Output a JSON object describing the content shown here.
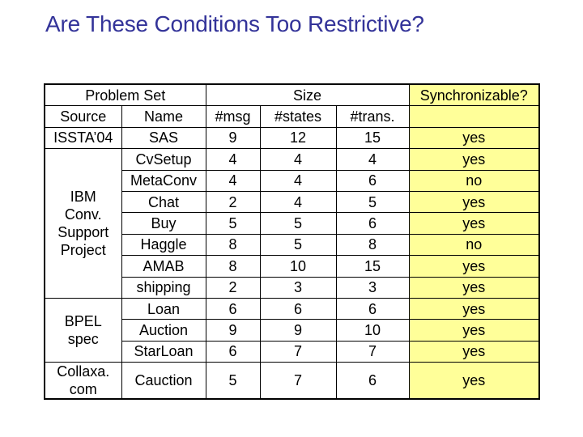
{
  "title": "Are These Conditions Too Restrictive?",
  "table": {
    "group_headers": {
      "problem_set": "Problem Set",
      "size": "Size",
      "synchronizable": "Synchronizable?"
    },
    "column_headers": {
      "source": "Source",
      "name": "Name",
      "msg": "#msg",
      "states": "#states",
      "trans": "#trans.",
      "sync": ""
    },
    "colors": {
      "sync_column_bg": "#ffff99",
      "title": "#333399",
      "border": "#000000"
    },
    "sources": [
      {
        "lines": [
          "ISSTA’04"
        ],
        "rowspan": 1
      },
      {
        "lines": [
          "IBM",
          "Conv.",
          "Support",
          "Project"
        ],
        "rowspan": 7
      },
      {
        "lines": [
          "BPEL",
          "spec"
        ],
        "rowspan": 3
      },
      {
        "lines": [
          "Collaxa.",
          "com"
        ],
        "rowspan": 2
      }
    ],
    "rows": [
      {
        "name": "SAS",
        "msg": "9",
        "states": "12",
        "trans": "15",
        "sync": "yes"
      },
      {
        "name": "CvSetup",
        "msg": "4",
        "states": "4",
        "trans": "4",
        "sync": "yes"
      },
      {
        "name": "MetaConv",
        "msg": "4",
        "states": "4",
        "trans": "6",
        "sync": "no"
      },
      {
        "name": "Chat",
        "msg": "2",
        "states": "4",
        "trans": "5",
        "sync": "yes"
      },
      {
        "name": "Buy",
        "msg": "5",
        "states": "5",
        "trans": "6",
        "sync": "yes"
      },
      {
        "name": "Haggle",
        "msg": "8",
        "states": "5",
        "trans": "8",
        "sync": "no"
      },
      {
        "name": "AMAB",
        "msg": "8",
        "states": "10",
        "trans": "15",
        "sync": "yes"
      },
      {
        "name": "shipping",
        "msg": "2",
        "states": "3",
        "trans": "3",
        "sync": "yes"
      },
      {
        "name": "Loan",
        "msg": "6",
        "states": "6",
        "trans": "6",
        "sync": "yes"
      },
      {
        "name": "Auction",
        "msg": "9",
        "states": "9",
        "trans": "10",
        "sync": "yes"
      },
      {
        "name": "StarLoan",
        "msg": "6",
        "states": "7",
        "trans": "7",
        "sync": "yes"
      },
      {
        "name": "Cauction",
        "msg": "5",
        "states": "7",
        "trans": "6",
        "sync": "yes"
      }
    ]
  }
}
